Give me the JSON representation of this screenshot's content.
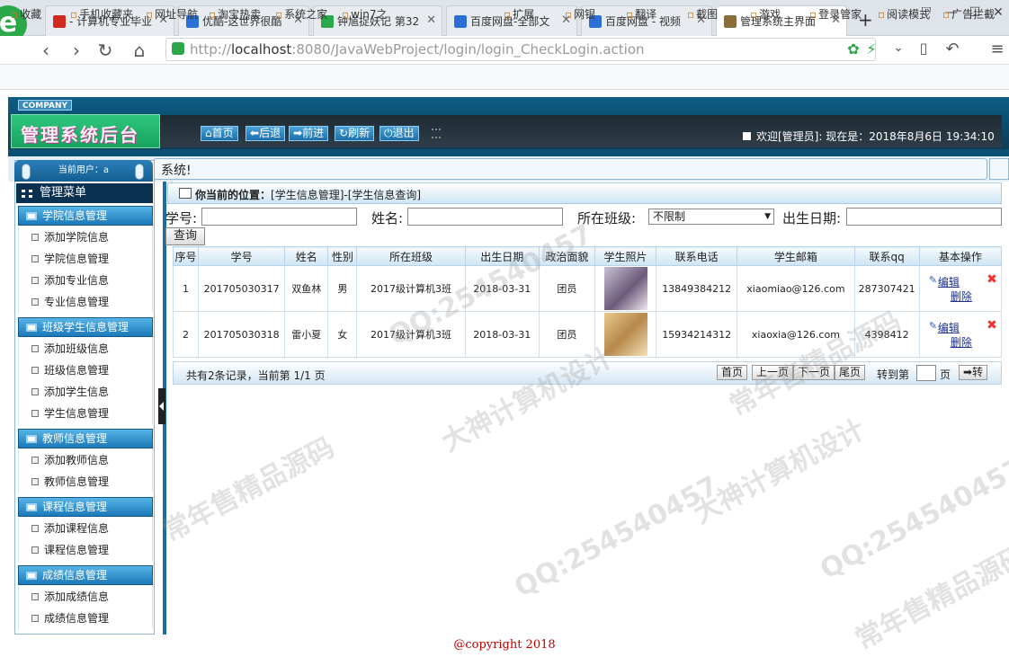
{
  "browser": {
    "tabs": [
      {
        "label": "- 计算机专业毕业",
        "color": "#d02a1f"
      },
      {
        "label": "优酷-这世界很酷",
        "color": "#2a6fd6"
      },
      {
        "label": "钟馗捉妖记 第32",
        "color": "#2aa84a"
      },
      {
        "label": "百度网盘-全部文",
        "color": "#2a6fd6"
      },
      {
        "label": "百度网盘 - 视频",
        "color": "#2a6fd6"
      },
      {
        "label": "管理系统主界面",
        "color": "#8a6d3b"
      }
    ],
    "new_tab": "+",
    "url_host": "localhost",
    "url_prefix": "http://",
    "url_suffix": ":8080/JavaWebProject/login/login_CheckLogin.action",
    "bookmarks": [
      "收藏",
      "手机收藏夹",
      "网址导航",
      "淘宝热卖",
      "系统之家",
      "win7之",
      "扩展",
      "网银",
      "翻译",
      "截图",
      "游戏",
      "登录管家",
      "阅读模式",
      "广告拦截"
    ]
  },
  "app": {
    "company": "COMPANY",
    "title": "管理系统后台",
    "buttons": [
      "首页",
      "后退",
      "前进",
      "刷新",
      "退出"
    ],
    "welcome": "欢迎[管理员]:  现在是：2018年8月6日 19:34:10",
    "current_user": "当前用户：a",
    "system_text": "系统!",
    "menu_title": "管理菜单",
    "menu": [
      {
        "group": "学院信息管理",
        "items": [
          "添加学院信息",
          "学院信息管理",
          "添加专业信息",
          "专业信息管理"
        ]
      },
      {
        "group": "班级学生信息管理",
        "items": [
          "添加班级信息",
          "班级信息管理",
          "添加学生信息",
          "学生信息管理"
        ]
      },
      {
        "group": "教师信息管理",
        "items": [
          "添加教师信息",
          "教师信息管理"
        ]
      },
      {
        "group": "课程信息管理",
        "items": [
          "添加课程信息",
          "课程信息管理"
        ]
      },
      {
        "group": "成绩信息管理",
        "items": [
          "添加成绩信息",
          "成绩信息管理"
        ]
      }
    ]
  },
  "content": {
    "crumb_label": "你当前的位置：",
    "crumb_path": "[学生信息管理]-[学生信息查询]",
    "filters": {
      "student_no": "学号:",
      "name": "姓名:",
      "class": "所在班级:",
      "class_value": "不限制",
      "birth": "出生日期:"
    },
    "query_btn": "查询",
    "headers": [
      "序号",
      "学号",
      "姓名",
      "性别",
      "所在班级",
      "出生日期",
      "政治面貌",
      "学生照片",
      "联系电话",
      "学生邮箱",
      "联系qq",
      "基本操作"
    ],
    "rows": [
      {
        "no": "1",
        "sid": "201705030317",
        "name": "双鱼林",
        "sex": "男",
        "class": "2017级计算机3班",
        "birth": "2018-03-31",
        "political": "团员",
        "phone": "13849384212",
        "email": "xiaomiao@126.com",
        "qq": "287307421",
        "edit": "编辑",
        "del": "删除"
      },
      {
        "no": "2",
        "sid": "201705030318",
        "name": "雷小夏",
        "sex": "女",
        "class": "2017级计算机3班",
        "birth": "2018-03-31",
        "political": "团员",
        "phone": "15934214312",
        "email": "xiaoxia@126.com",
        "qq": "4398412",
        "edit": "编辑",
        "del": "删除"
      }
    ],
    "pager_text": "共有2条记录，当前第 1/1 页",
    "pager_btns": [
      "首页",
      "上一页",
      "下一页",
      "尾页"
    ],
    "goto": "转到第",
    "page_unit": "页",
    "go_btn": "➡转"
  },
  "footer": "@copyright 2018",
  "watermarks": [
    "常年售精品源码",
    "QQ:254540457",
    "大神计算机设计",
    "常年售精品源码",
    "QQ:254540457",
    "大神计算机设计",
    "QQ:254540457",
    "常年售精品源码"
  ]
}
